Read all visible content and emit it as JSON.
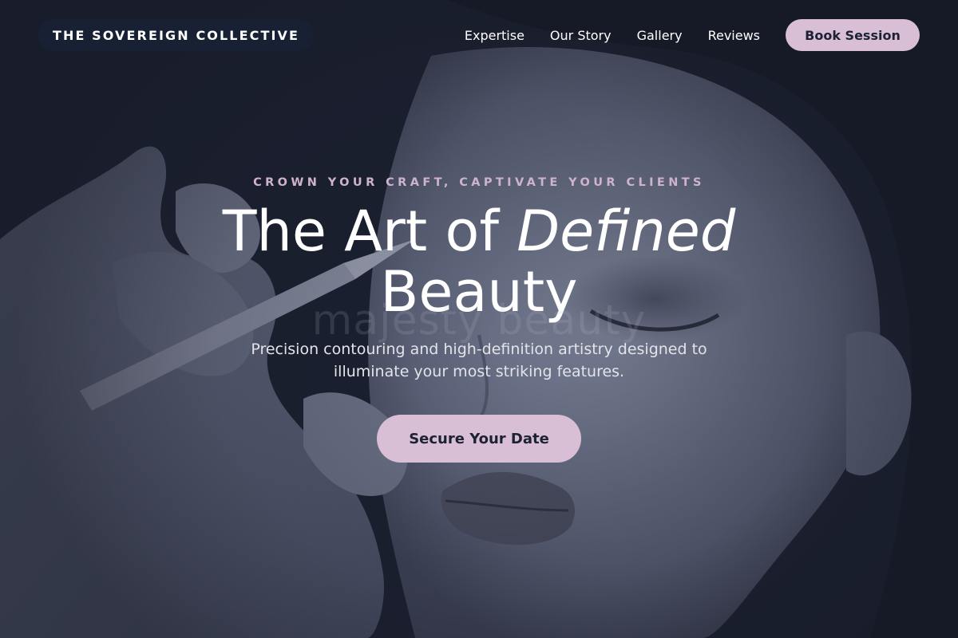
{
  "header": {
    "brand": "THE SOVEREIGN COLLECTIVE",
    "nav": [
      {
        "label": "Expertise"
      },
      {
        "label": "Our Story"
      },
      {
        "label": "Gallery"
      },
      {
        "label": "Reviews"
      }
    ],
    "cta_label": "Book Session"
  },
  "hero": {
    "eyebrow": "CROWN YOUR CRAFT, CAPTIVATE YOUR CLIENTS",
    "headline_part1": "The Art of ",
    "headline_emphasis": "Defined",
    "headline_part2": "Beauty",
    "watermark": "majesty beauty",
    "subtitle": "Precision contouring and high-definition artistry designed to illuminate your most striking features.",
    "cta_label": "Secure Your Date",
    "background": "makeup-artist-applying-brow-pencil-photo"
  },
  "colors": {
    "background": "#1b2030",
    "accent": "#d9bfd6",
    "eyebrow": "#cfb3cd",
    "dark_text": "#1c2233"
  }
}
